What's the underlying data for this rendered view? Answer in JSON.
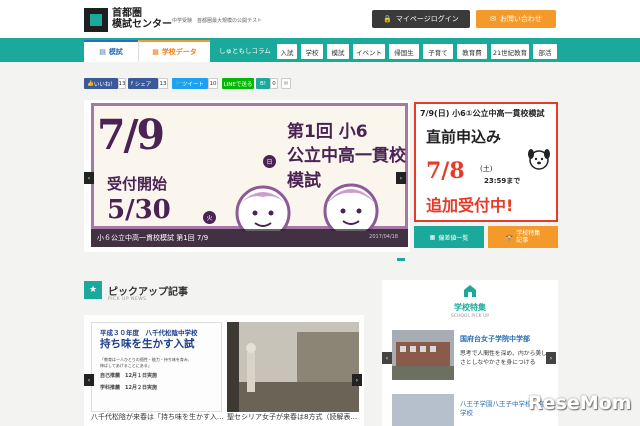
{
  "header": {
    "logo_line1": "首都圏",
    "logo_line2": "模試センター",
    "tagline": "中学受験　首都圏最大規模の公開テスト",
    "login_label": "マイページログイン",
    "contact_label": "お問い合わせ"
  },
  "nav": {
    "tab_mock": "模試",
    "tab_school": "学校データ",
    "column_link": "しゅともしコラム",
    "categories": [
      "入試",
      "学校",
      "模試",
      "イベント",
      "帰国生",
      "子育て",
      "教育費",
      "21世紀教育",
      "部活"
    ]
  },
  "social": {
    "like": "いいね！",
    "like_count": "13",
    "share": "シェア",
    "share_count": "13",
    "tweet": "ツイート",
    "tweet_count": "10",
    "line": "LINEで送る",
    "other_count": "0"
  },
  "main_banner": {
    "date": "7/9",
    "day": "日",
    "title_line1": "第1回 小6",
    "title_line2": "公立中高一貫校模試",
    "subtitle": "受付開始",
    "date2": "5/30",
    "day2": "火",
    "caption": "小６公立中高一貫校模試 第1回 7/9",
    "caption_date": "2017/04/18"
  },
  "side_banner": {
    "head": "7/9(日) 小6①公立中高一貫校模試",
    "main": "直前申込み",
    "date": "7/8",
    "paren": "(土)",
    "time": "23:59まで",
    "add": "追加受付中!"
  },
  "quick_buttons": {
    "deviation": "偏差値一覧",
    "feature_line1": "学校特集",
    "feature_line2": "記事"
  },
  "pickup": {
    "title": "ピックアップ記事",
    "subtitle": "PICK UP NEWS",
    "card1_head": "平成３０年度　八千代松陰中学校",
    "card1_title": "持ち味を生かす入試",
    "card1_lines": [
      "「教育は一人ひとりの個性・能力・持ち味を育み、",
      "伸ばしてあげることにある」",
      "自己推薦　12月１日実施",
      "学科推薦　12月２日実施"
    ],
    "card1_caption": "八千代松陰が来春は「持ち味を生かす入...",
    "card2_caption": "聖セシリア女子が来春は8方式（読解表..."
  },
  "school_feature": {
    "title": "学校特集",
    "subtitle": "SCHOOL PICK UP",
    "name1": "国府台女子学院中学部",
    "desc1": "思考で人間性を深め、内から美しさとしなやかさを身につける",
    "name2": "八王子学園八王子中学校・高等学校"
  },
  "watermark": "ReseMom",
  "colors": {
    "teal": "#1aa99a",
    "orange": "#f39a2a",
    "purple": "#a578a8",
    "red": "#e63b28"
  }
}
